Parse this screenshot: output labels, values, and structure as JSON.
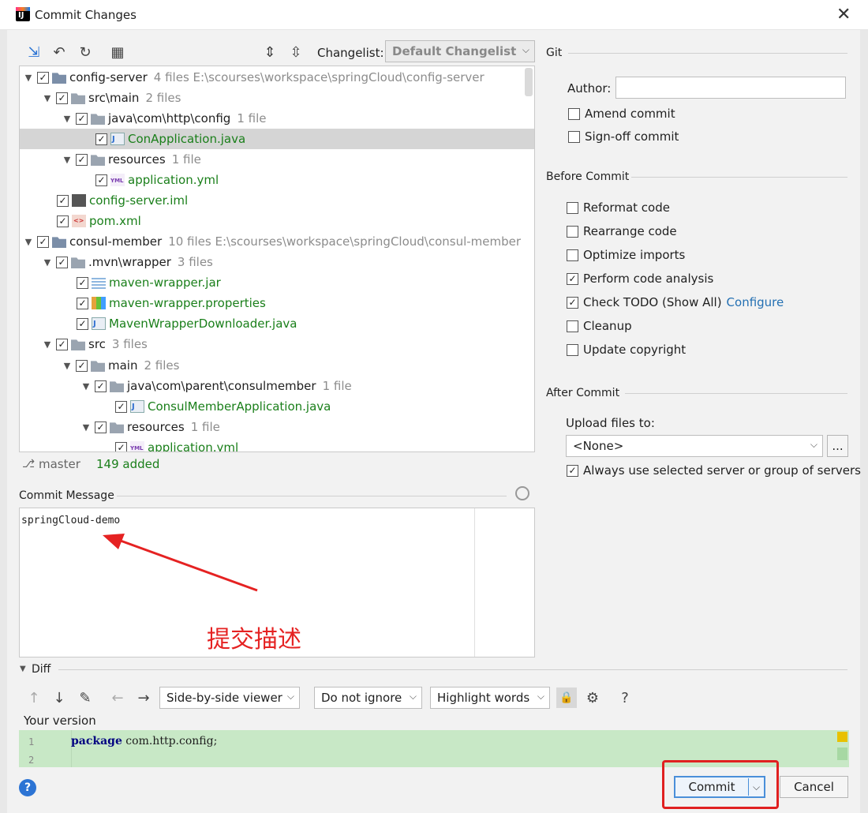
{
  "window": {
    "title": "Commit Changes",
    "close": "✕"
  },
  "toolbar": {
    "changelist_label": "Changelist:",
    "changelist_value": "Default Changelist"
  },
  "tree": [
    {
      "name": "config-server",
      "meta": "4 files  E:\\scourses\\workspace\\springCloud\\config-server"
    },
    {
      "name": "src\\main",
      "meta": "2 files"
    },
    {
      "name": "java\\com\\http\\config",
      "meta": "1 file"
    },
    {
      "name": "ConApplication.java",
      "meta": ""
    },
    {
      "name": "resources",
      "meta": "1 file"
    },
    {
      "name": "application.yml",
      "meta": ""
    },
    {
      "name": "config-server.iml",
      "meta": ""
    },
    {
      "name": "pom.xml",
      "meta": ""
    },
    {
      "name": "consul-member",
      "meta": "10 files  E:\\scourses\\workspace\\springCloud\\consul-member"
    },
    {
      "name": ".mvn\\wrapper",
      "meta": "3 files"
    },
    {
      "name": "maven-wrapper.jar",
      "meta": ""
    },
    {
      "name": "maven-wrapper.properties",
      "meta": ""
    },
    {
      "name": "MavenWrapperDownloader.java",
      "meta": ""
    },
    {
      "name": "src",
      "meta": "3 files"
    },
    {
      "name": "main",
      "meta": "2 files"
    },
    {
      "name": "java\\com\\parent\\consulmember",
      "meta": "1 file"
    },
    {
      "name": "ConsulMemberApplication.java",
      "meta": ""
    },
    {
      "name": "resources",
      "meta": "1 file"
    },
    {
      "name": "application.yml",
      "meta": ""
    }
  ],
  "status": {
    "branch": "master",
    "added": "149 added"
  },
  "commit_message": {
    "label": "Commit Message",
    "text": "springCloud-demo",
    "annotation": "提交描述"
  },
  "git": {
    "section": "Git",
    "author_label": "Author:",
    "amend": "Amend commit",
    "signoff": "Sign-off commit"
  },
  "before_commit": {
    "section": "Before Commit",
    "options": [
      {
        "label": "Reformat code",
        "checked": false
      },
      {
        "label": "Rearrange code",
        "checked": false
      },
      {
        "label": "Optimize imports",
        "checked": false
      },
      {
        "label": "Perform code analysis",
        "checked": true
      },
      {
        "label": "Check TODO (Show All)",
        "checked": true
      },
      {
        "label": "Cleanup",
        "checked": false
      },
      {
        "label": "Update copyright",
        "checked": false
      }
    ],
    "configure": "Configure"
  },
  "after_commit": {
    "section": "After Commit",
    "upload_label": "Upload files to:",
    "upload_value": "<None>",
    "browse": "...",
    "always_use": "Always use selected server or group of servers"
  },
  "diff": {
    "section": "Diff",
    "viewer": "Side-by-side viewer",
    "ignore": "Do not ignore",
    "highlight": "Highlight words",
    "help": "?",
    "your_version": "Your version",
    "line1_no": "1",
    "line2_no": "2",
    "keyword": "package",
    "code_rest": " com.http.config;"
  },
  "buttons": {
    "commit": "Commit",
    "cancel": "Cancel",
    "help": "?"
  },
  "colors": {
    "accent": "#2470b3",
    "added_green": "#1a7f1a",
    "annotation_red": "#e52222",
    "diff_bg": "#c8e8c6"
  }
}
